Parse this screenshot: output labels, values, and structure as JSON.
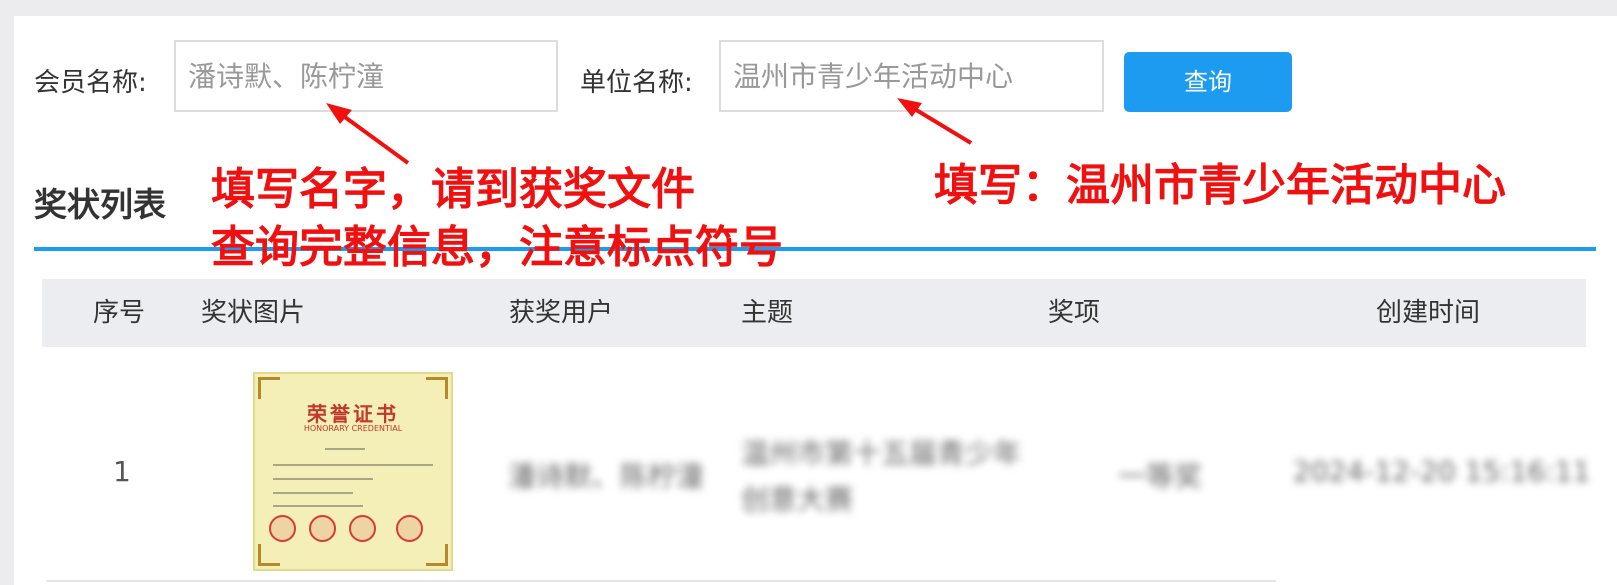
{
  "search": {
    "member_label": "会员名称:",
    "member_value": "潘诗默、陈柠潼",
    "unit_label": "单位名称:",
    "unit_value": "温州市青少年活动中心",
    "query_button": "查询"
  },
  "list_title": "奖状列表",
  "annotations": {
    "left_line1": "填写名字，请到获奖文件",
    "left_line2": "查询完整信息，注意标点符号",
    "right": "填写：温州市青少年活动中心"
  },
  "table": {
    "headers": [
      "序号",
      "奖状图片",
      "获奖用户",
      "主题",
      "奖项",
      "创建时间"
    ],
    "rows": [
      {
        "index": "1",
        "user": "潘诗默、陈柠潼",
        "topic_line1": "温州市第十五届青少年",
        "topic_line2": "创意大赛",
        "award": "一等奖",
        "created": "2024-12-20 15:16:11"
      }
    ]
  },
  "certificate": {
    "title": "荣誉证书",
    "subtitle": "HONORARY CREDENTIAL"
  },
  "colors": {
    "accent": "#1d9bf0",
    "annotation": "#f01010"
  }
}
